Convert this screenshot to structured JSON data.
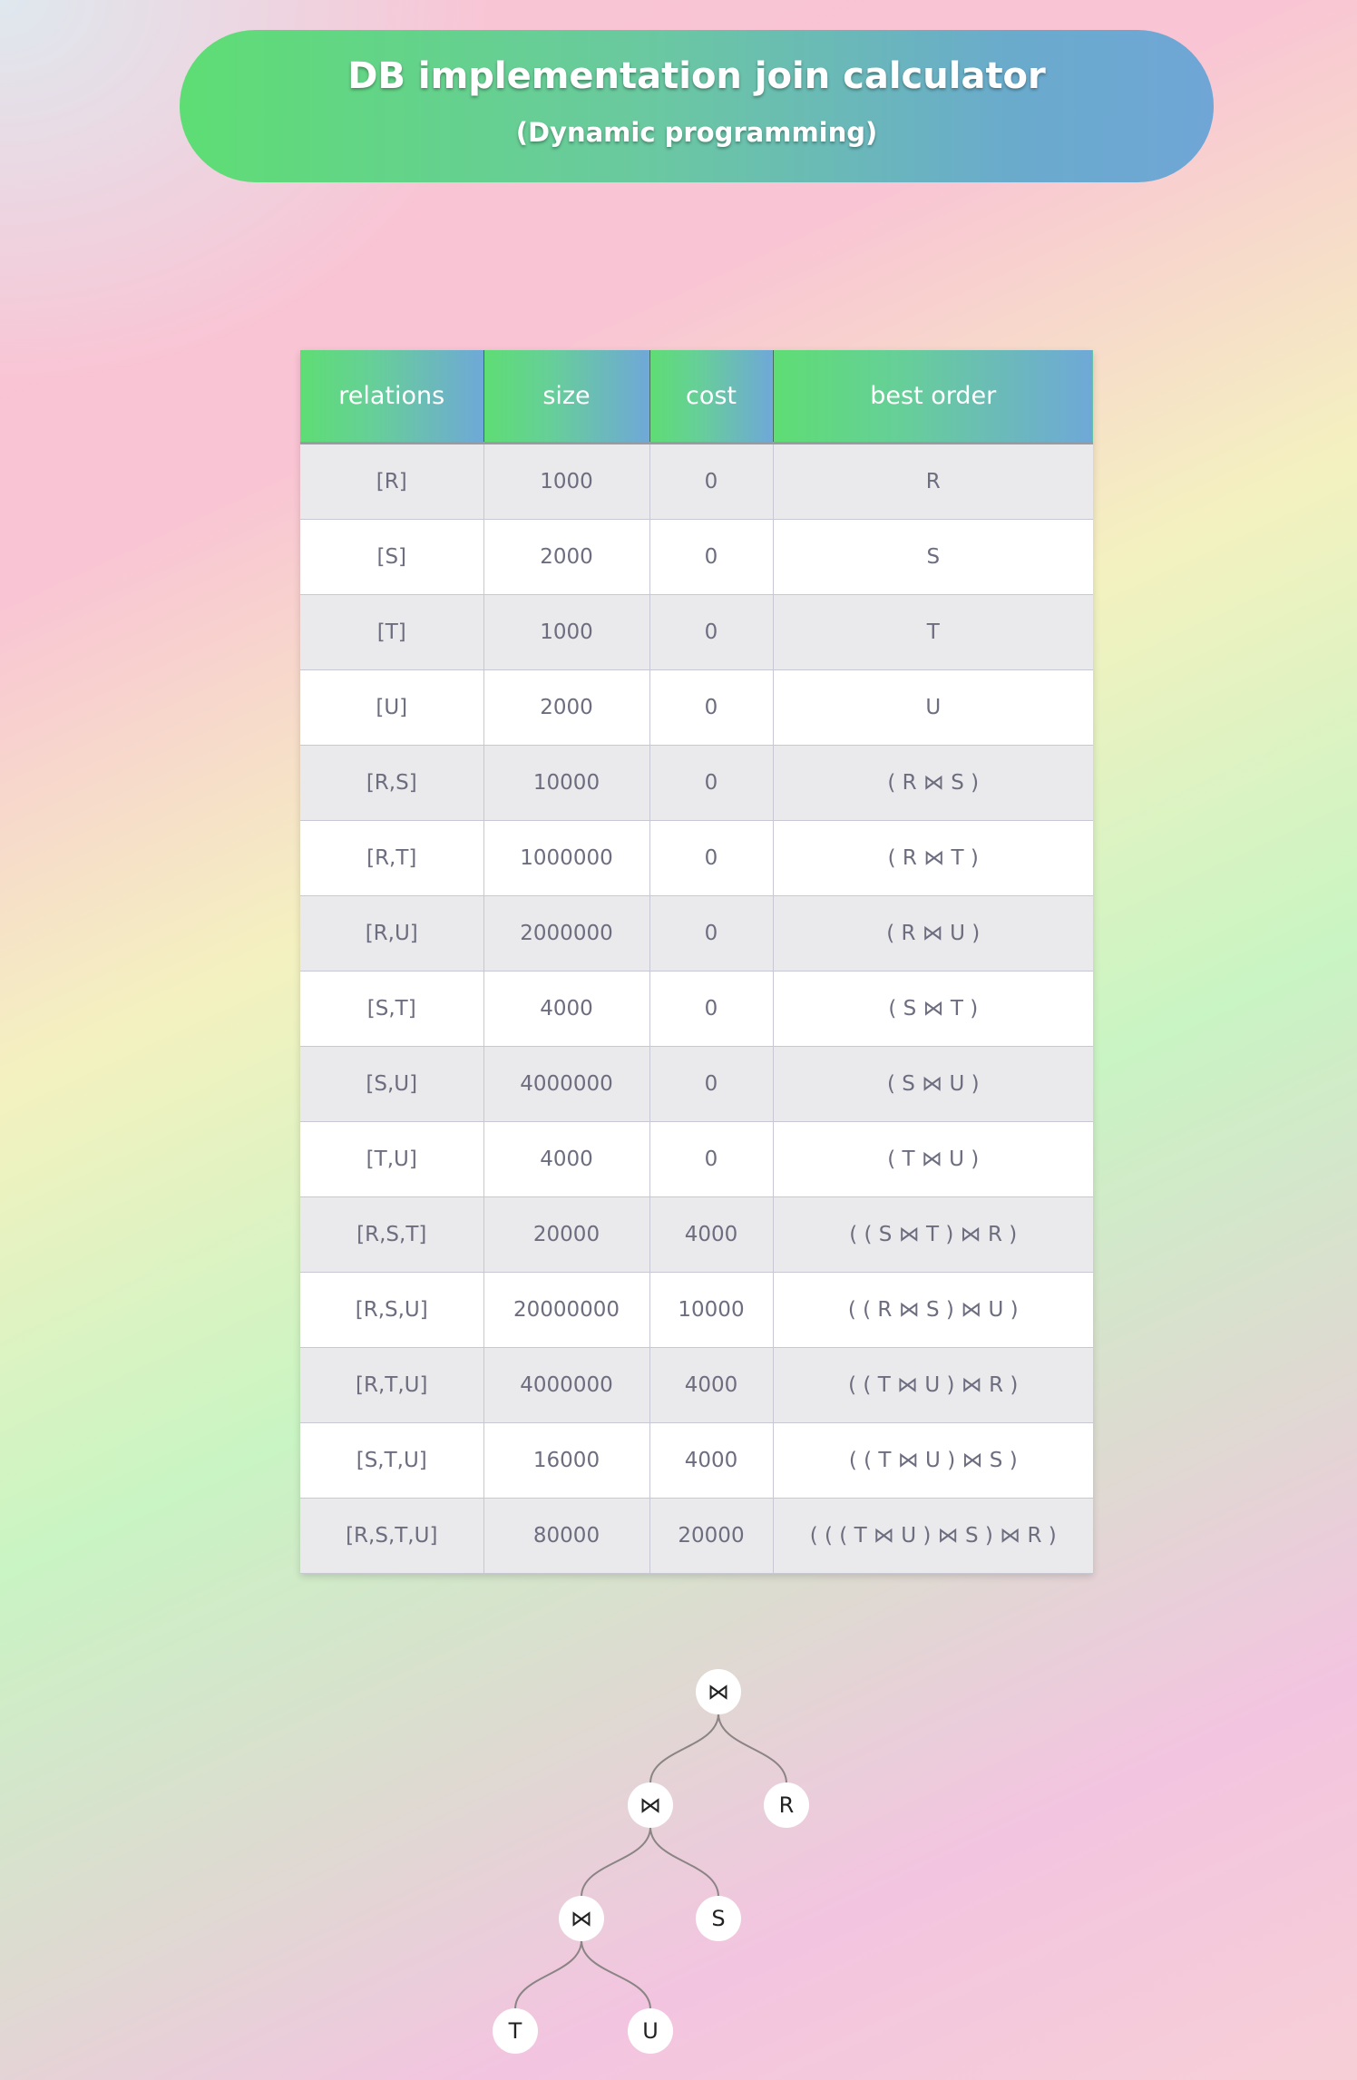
{
  "header": {
    "title": "DB implementation join calculator",
    "subtitle": "(Dynamic programming)"
  },
  "table": {
    "columns": [
      "relations",
      "size",
      "cost",
      "best order"
    ],
    "rows": [
      {
        "relations": "[R]",
        "size": "1000",
        "cost": "0",
        "best_order": "R"
      },
      {
        "relations": "[S]",
        "size": "2000",
        "cost": "0",
        "best_order": "S"
      },
      {
        "relations": "[T]",
        "size": "1000",
        "cost": "0",
        "best_order": "T"
      },
      {
        "relations": "[U]",
        "size": "2000",
        "cost": "0",
        "best_order": "U"
      },
      {
        "relations": "[R,S]",
        "size": "10000",
        "cost": "0",
        "best_order": "( R ⋈ S )"
      },
      {
        "relations": "[R,T]",
        "size": "1000000",
        "cost": "0",
        "best_order": "( R ⋈ T )"
      },
      {
        "relations": "[R,U]",
        "size": "2000000",
        "cost": "0",
        "best_order": "( R ⋈ U )"
      },
      {
        "relations": "[S,T]",
        "size": "4000",
        "cost": "0",
        "best_order": "( S ⋈ T )"
      },
      {
        "relations": "[S,U]",
        "size": "4000000",
        "cost": "0",
        "best_order": "( S ⋈ U )"
      },
      {
        "relations": "[T,U]",
        "size": "4000",
        "cost": "0",
        "best_order": "( T ⋈ U )"
      },
      {
        "relations": "[R,S,T]",
        "size": "20000",
        "cost": "4000",
        "best_order": "( ( S ⋈ T ) ⋈ R )"
      },
      {
        "relations": "[R,S,U]",
        "size": "20000000",
        "cost": "10000",
        "best_order": "( ( R ⋈ S ) ⋈ U )"
      },
      {
        "relations": "[R,T,U]",
        "size": "4000000",
        "cost": "4000",
        "best_order": "( ( T ⋈ U ) ⋈ R )"
      },
      {
        "relations": "[S,T,U]",
        "size": "16000",
        "cost": "4000",
        "best_order": "( ( T ⋈ U ) ⋈ S )"
      },
      {
        "relations": "[R,S,T,U]",
        "size": "80000",
        "cost": "20000",
        "best_order": "( ( ( T ⋈ U ) ⋈ S ) ⋈ R )"
      }
    ]
  },
  "join_tree": {
    "nodes": [
      {
        "id": "j1",
        "label": "⋈"
      },
      {
        "id": "j2",
        "label": "⋈"
      },
      {
        "id": "j3",
        "label": "⋈"
      },
      {
        "id": "R",
        "label": "R"
      },
      {
        "id": "S",
        "label": "S"
      },
      {
        "id": "T",
        "label": "T"
      },
      {
        "id": "U",
        "label": "U"
      }
    ],
    "edges": [
      [
        "j1",
        "j2"
      ],
      [
        "j1",
        "R"
      ],
      [
        "j2",
        "j3"
      ],
      [
        "j2",
        "S"
      ],
      [
        "j3",
        "T"
      ],
      [
        "j3",
        "U"
      ]
    ]
  }
}
